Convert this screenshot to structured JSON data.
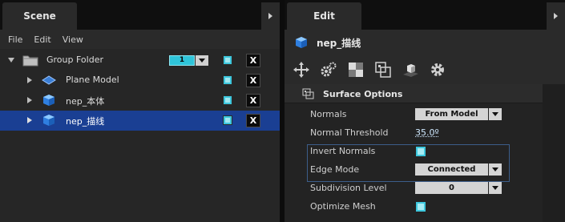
{
  "scene": {
    "tab_label": "Scene",
    "menu": [
      "File",
      "Edit",
      "View"
    ],
    "tree": [
      {
        "label": "Group Folder",
        "expander": "open",
        "icon": "folder-icon",
        "count": "1"
      },
      {
        "label": "Plane Model",
        "expander": "closed",
        "icon": "plane-model-icon"
      },
      {
        "label": "nep_本体",
        "expander": "closed",
        "icon": "cube-icon"
      },
      {
        "label": "nep_描线",
        "expander": "closed",
        "icon": "cube-icon",
        "selected": true
      }
    ],
    "delete_label": "X"
  },
  "edit": {
    "tab_label": "Edit",
    "object_name": "nep_描线",
    "tools": [
      "move-icon",
      "gears-icon",
      "checker-icon",
      "transform-icon",
      "shadow-box-icon",
      "gear-icon"
    ],
    "section_title": "Surface Options",
    "props": {
      "normals": {
        "label": "Normals",
        "value": "From Model"
      },
      "normal_threshold": {
        "label": "Normal Threshold",
        "value": "35.0º"
      },
      "invert_normals": {
        "label": "Invert Normals",
        "checked": true
      },
      "edge_mode": {
        "label": "Edge Mode",
        "value": "Connected"
      },
      "subdivision_level": {
        "label": "Subdivision Level",
        "value": "0"
      },
      "optimize_mesh": {
        "label": "Optimize Mesh",
        "checked": true
      }
    }
  },
  "colors": {
    "selection": "#1a3f93",
    "accent": "#3cc7dd",
    "panel": "#262626"
  }
}
